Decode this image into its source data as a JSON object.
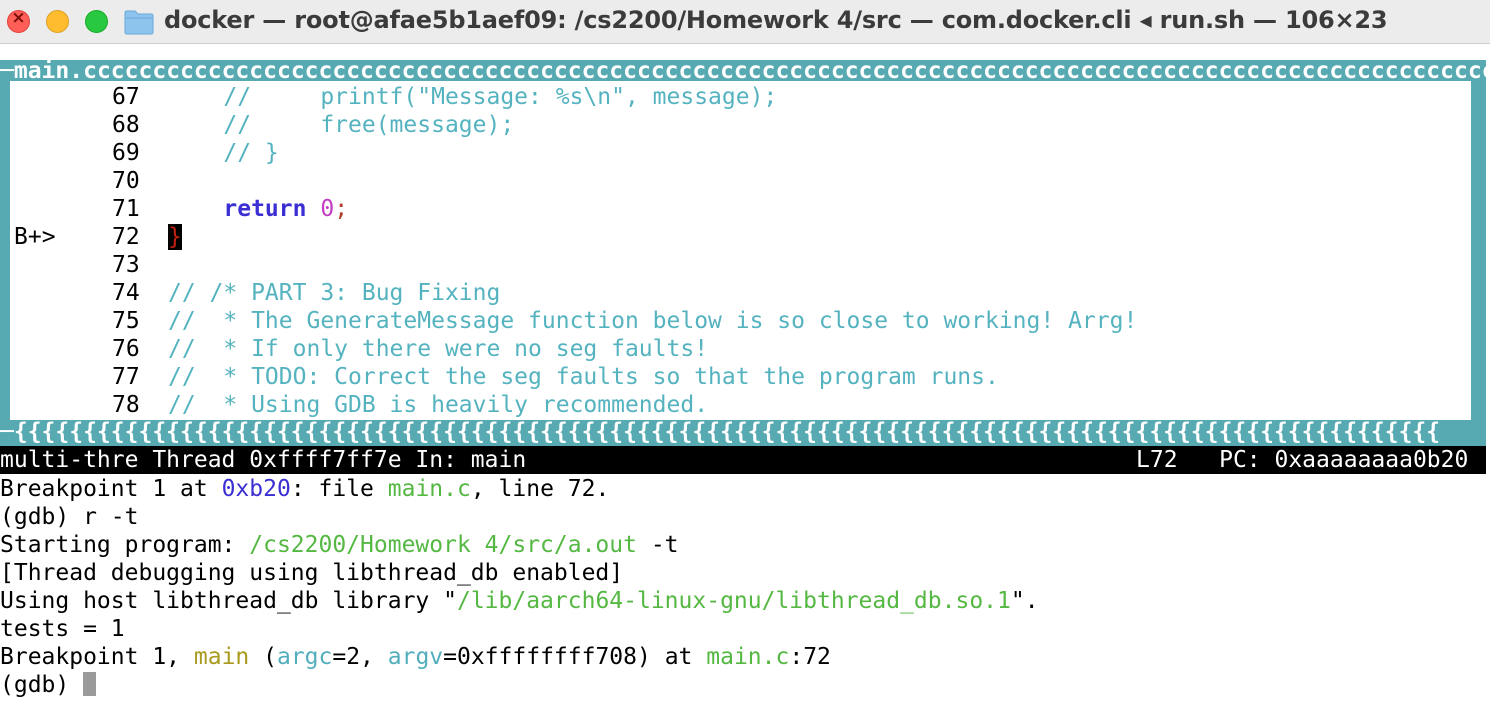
{
  "window": {
    "title": "docker — root@afae5b1aef09: /cs2200/Homework 4/src — com.docker.cli ◂ run.sh — 106×23",
    "buttons": [
      "close",
      "minimize",
      "maximize"
    ],
    "folder_icon": "folder-icon"
  },
  "source_window": {
    "header": "main.c",
    "top_fill": "ccccccccccccccccccccccccccccccccccccccccccccccccccccccccccccccccccccccccccccccccccccccccccccccccccccc",
    "bottom_fill": "{{{{{{{{{{{{{{{{{{{{{{{{{{{{{{{{{{{{{{{{{{{{{{{{{{{{{{{{{{{{{{{{{{{{{{{{{{{{{{{{{{{{{{{{{{{{{{{{{{{{{{{",
    "lines": [
      {
        "num": "67",
        "marker": "",
        "text": "    //     printf(\"Message: %s\\n\", message);"
      },
      {
        "num": "68",
        "marker": "",
        "text": "    //     free(message);"
      },
      {
        "num": "69",
        "marker": "",
        "text": "    // }"
      },
      {
        "num": "70",
        "marker": "",
        "text": ""
      },
      {
        "num": "71",
        "marker": "",
        "kw": "return",
        "num_val": "0",
        "semi": ";"
      },
      {
        "num": "72",
        "marker": "B+>",
        "brace": "}"
      },
      {
        "num": "73",
        "marker": "",
        "text": ""
      },
      {
        "num": "74",
        "marker": "",
        "text": "// /* PART 3: Bug Fixing"
      },
      {
        "num": "75",
        "marker": "",
        "text": "//  * The GenerateMessage function below is so close to working! Arrg!"
      },
      {
        "num": "76",
        "marker": "",
        "text": "//  * If only there were no seg faults!"
      },
      {
        "num": "77",
        "marker": "",
        "text": "//  * TODO: Correct the seg faults so that the program runs."
      },
      {
        "num": "78",
        "marker": "",
        "text": "//  * Using GDB is heavily recommended."
      }
    ]
  },
  "status": {
    "left": "multi-thre Thread 0xffff7ff7e In: main",
    "line": "L72",
    "pc": "PC: 0xaaaaaaaa0b20"
  },
  "console": {
    "l1": {
      "a": "Breakpoint 1 at ",
      "addr": "0xb20",
      "b": ": file ",
      "file": "main.c",
      "c": ", line 72."
    },
    "l2": "(gdb) r -t",
    "l3": {
      "a": "Starting program: ",
      "path": "/cs2200/Homework 4/src/a.out",
      "b": " -t"
    },
    "l4": "[Thread debugging using libthread_db enabled]",
    "l5": {
      "a": "Using host libthread_db library \"",
      "path": "/lib/aarch64-linux-gnu/libthread_db.so.1",
      "b": "\"."
    },
    "l6": "tests = 1",
    "l7": {
      "a": "Breakpoint 1, ",
      "func": "main",
      "b": " (",
      "arg1": "argc",
      "c": "=2, ",
      "arg2": "argv",
      "d": "=0xffffffff708) at ",
      "file": "main.c",
      "e": ":72"
    },
    "prompt": "(gdb) "
  },
  "colors": {
    "frame": "#58aab2",
    "comment": "#55b3c0",
    "keyword": "#3b2fd3",
    "number": "#c33cc4",
    "path": "#55b843",
    "func": "#a89b1e"
  }
}
